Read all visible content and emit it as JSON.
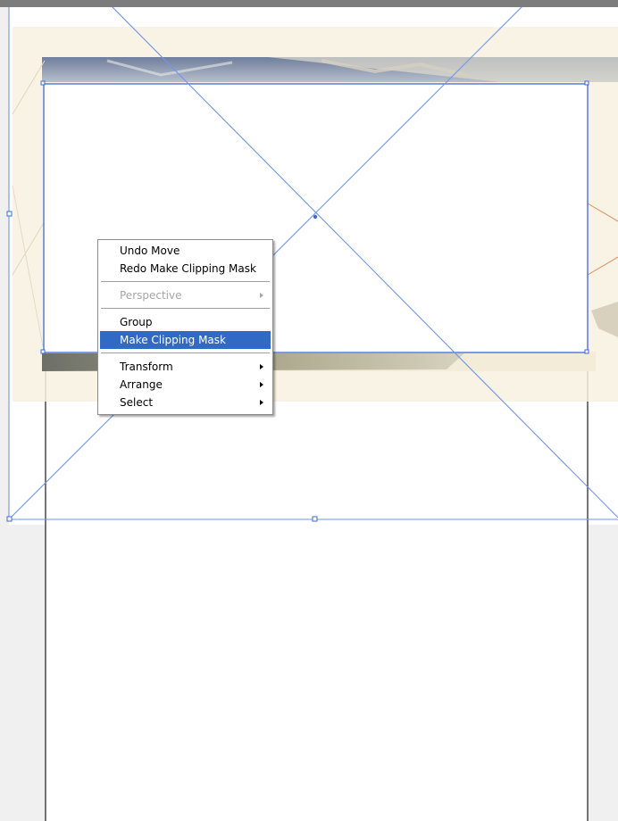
{
  "context_menu": {
    "undo_label": "Undo Move",
    "redo_label": "Redo Make Clipping Mask",
    "perspective_label": "Perspective",
    "group_label": "Group",
    "clipping_mask_label": "Make Clipping Mask",
    "transform_label": "Transform",
    "arrange_label": "Arrange",
    "select_label": "Select"
  },
  "colors": {
    "selection_blue": "#4f7fe8",
    "menu_highlight": "#316ac5",
    "pasteboard": "#f0f0f0"
  },
  "icons": [
    "submenu-arrow-icon",
    "anchor-point-icon",
    "center-point-icon"
  ]
}
